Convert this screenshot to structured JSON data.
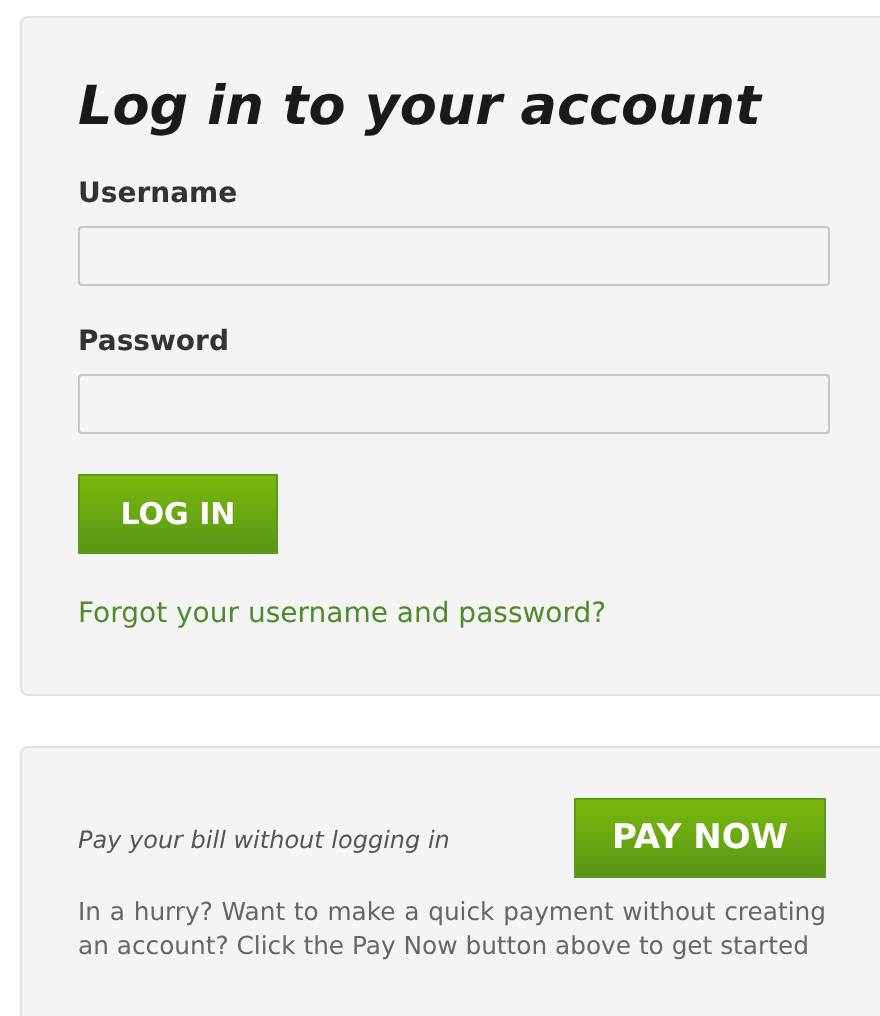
{
  "login": {
    "title": "Log in to your account",
    "fields": [
      {
        "label": "Username"
      },
      {
        "label": "Password"
      }
    ],
    "button": "LOG IN",
    "forgot_link": "Forgot your username and password?"
  },
  "quick_pay": {
    "prompt": "Pay your bill without logging in",
    "button": "PAY NOW",
    "description": "In a hurry? Want to make a quick payment without creating an account? Click the Pay Now button above to get started"
  }
}
